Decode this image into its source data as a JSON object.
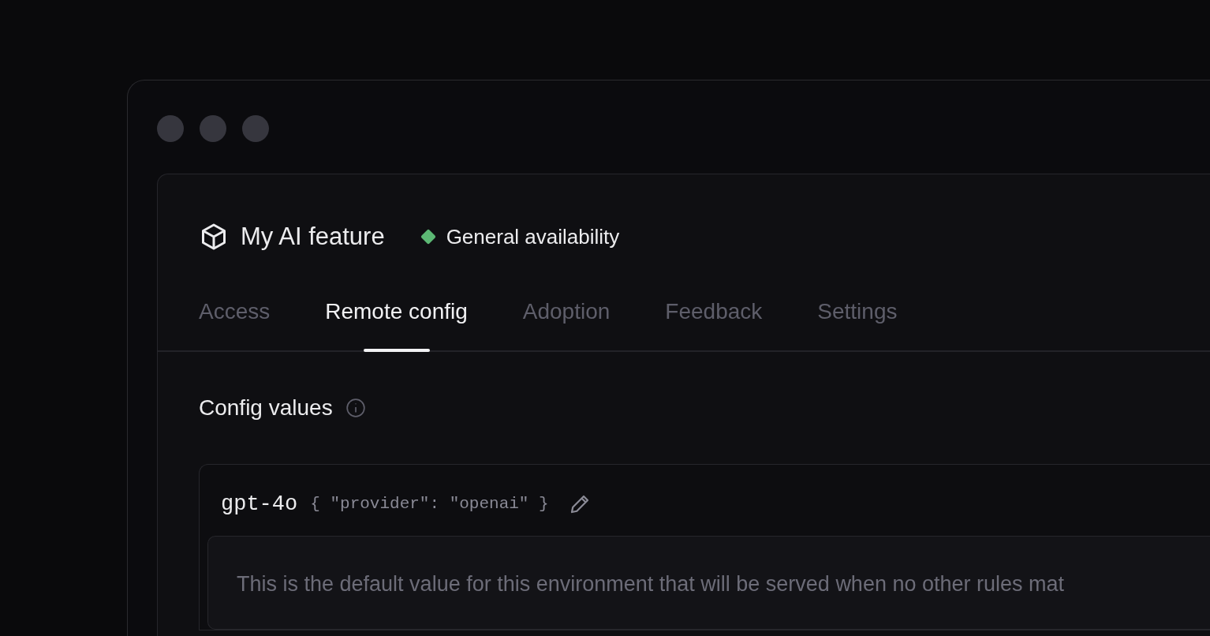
{
  "feature": {
    "title": "My AI feature",
    "status": {
      "label": "General availability",
      "color": "#5cb874"
    }
  },
  "tabs": [
    {
      "label": "Access",
      "selected": false
    },
    {
      "label": "Remote config",
      "selected": true
    },
    {
      "label": "Adoption",
      "selected": false
    },
    {
      "label": "Feedback",
      "selected": false
    },
    {
      "label": "Settings",
      "selected": false
    }
  ],
  "section": {
    "title": "Config values"
  },
  "config": {
    "name": "gpt-4o",
    "value": "{ \"provider\": \"openai\" }",
    "description": "This is the default value for this environment that will be served when no other rules mat"
  }
}
